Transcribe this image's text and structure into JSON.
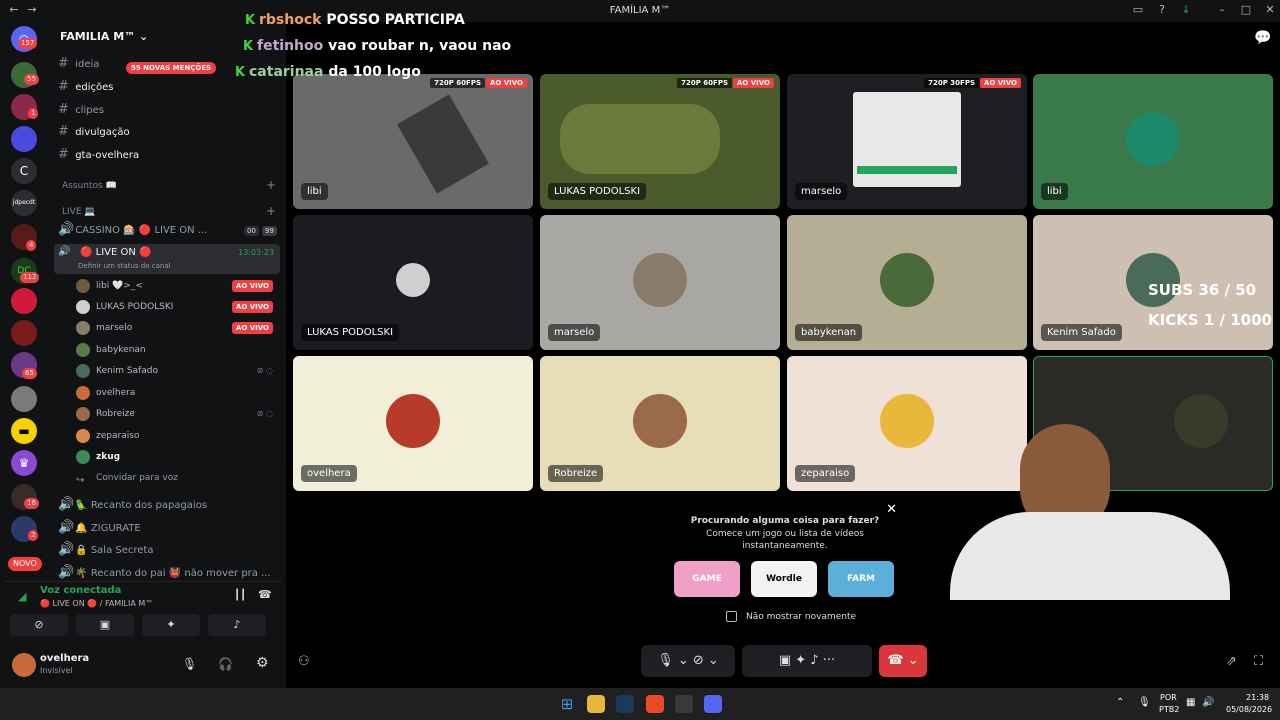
{
  "window": {
    "title": "FAMÍLIA M™"
  },
  "chat_overlay": [
    {
      "user": "rbshock",
      "message": "POSSO PARTICIPA"
    },
    {
      "user": "fetinhoo",
      "message": "vao roubar n, vaou nao"
    },
    {
      "user": "catarinaa",
      "message": "da 100 logo"
    }
  ],
  "server_rail": {
    "badges": [
      "157",
      "55",
      "1",
      "4",
      "112",
      "65",
      "16",
      "2"
    ],
    "letter_server": "C",
    "text_server": "jdpecdt",
    "new_label": "NOVO"
  },
  "server": {
    "name": "FAMILIA M™",
    "mentions_badge": "55 NOVAS MENÇÕES"
  },
  "channels": [
    {
      "name": "ideia"
    },
    {
      "name": "edições"
    },
    {
      "name": "clipes"
    },
    {
      "name": "divulgação"
    },
    {
      "name": "gta-ovelhera"
    }
  ],
  "categories": {
    "assuntos": "Assuntos 📖",
    "live": "LIVE 💻"
  },
  "voice_channels": {
    "cassino": {
      "name": "CASSINO 🎰 🔴 LIVE ON ...",
      "count1": "00",
      "count2": "99"
    },
    "live_on": {
      "name": "🔴 LIVE ON 🔴",
      "time": "13:03:23",
      "status": "Definir um status do canal"
    },
    "others": [
      "Recanto dos papagaios",
      "ZIGURATE",
      "Sala Secreta",
      "Recanto do pai 👹 não mover pra ..."
    ],
    "invite": "Convidar para voz"
  },
  "members": [
    {
      "name": "libi 🤍>_<",
      "live": "AO VIVO",
      "color": "#6e5b3d"
    },
    {
      "name": "LUKAS PODOLSKI",
      "live": "AO VIVO",
      "color": "#cfcfcf"
    },
    {
      "name": "marselo",
      "live": "AO VIVO",
      "color": "#8a7a6a"
    },
    {
      "name": "babykenan",
      "live": "",
      "color": "#5a7a4a"
    },
    {
      "name": "Kenim Safado",
      "live": "",
      "color": "#4a6a5a"
    },
    {
      "name": "ovelhera",
      "live": "",
      "color": "#c86a3a"
    },
    {
      "name": "Robreize",
      "live": "",
      "color": "#9a6a4a"
    },
    {
      "name": "zeparaiso",
      "live": "",
      "color": "#d88a4a"
    },
    {
      "name": "zkug",
      "live": "",
      "color": "#3a8a5a"
    }
  ],
  "voice_status": {
    "title": "Voz conectada",
    "channel": "🔴 LIVE ON 🔴 / FAMILIA M™"
  },
  "user_panel": {
    "name": "ovelhera",
    "status": "Invisível"
  },
  "tiles": [
    {
      "name": "libi",
      "flags": [
        "720P 60FPS",
        "AO VIVO"
      ],
      "bg": "#6a6a6a"
    },
    {
      "name": "LUKAS PODOLSKI",
      "flags": [
        "720P 60FPS",
        "AO VIVO"
      ],
      "bg": "#4a5a2a"
    },
    {
      "name": "marselo",
      "flags": [
        "720P 30FPS",
        "AO VIVO"
      ],
      "bg": "#1e1f22"
    },
    {
      "name": "libi",
      "flags": [],
      "bg": "#3a7a4a"
    },
    {
      "name": "LUKAS PODOLSKI",
      "flags": [],
      "bg": "#1a1c22"
    },
    {
      "name": "marselo",
      "flags": [],
      "bg": "#a9a8a4"
    },
    {
      "name": "babykenan",
      "flags": [],
      "bg": "#b6ad95"
    },
    {
      "name": "Kenim Safado",
      "flags": [],
      "bg": "#cdc0b3"
    },
    {
      "name": "ovelhera",
      "flags": [],
      "bg": "#f2efd9"
    },
    {
      "name": "Robreize",
      "flags": [],
      "bg": "#e8ddb9"
    },
    {
      "name": "zeparaiso",
      "flags": [],
      "bg": "#efe0d8"
    },
    {
      "name": "",
      "flags": [],
      "bg": "#2a2a26"
    }
  ],
  "subs_overlay": {
    "subs": "SUBS 36 / 50",
    "kicks": "KICKS 1 / 1000"
  },
  "activity_popup": {
    "title": "Procurando alguma coisa para fazer?",
    "body": "Comece um jogo ou lista de vídeos instantaneamente.",
    "games": [
      "GAME",
      "Wordle",
      "FARM"
    ],
    "checkbox": "Não mostrar novamente"
  },
  "taskbar": {
    "lang": "POR",
    "layout": "PTB2",
    "time": "21:38",
    "date": "05/08/2026"
  }
}
